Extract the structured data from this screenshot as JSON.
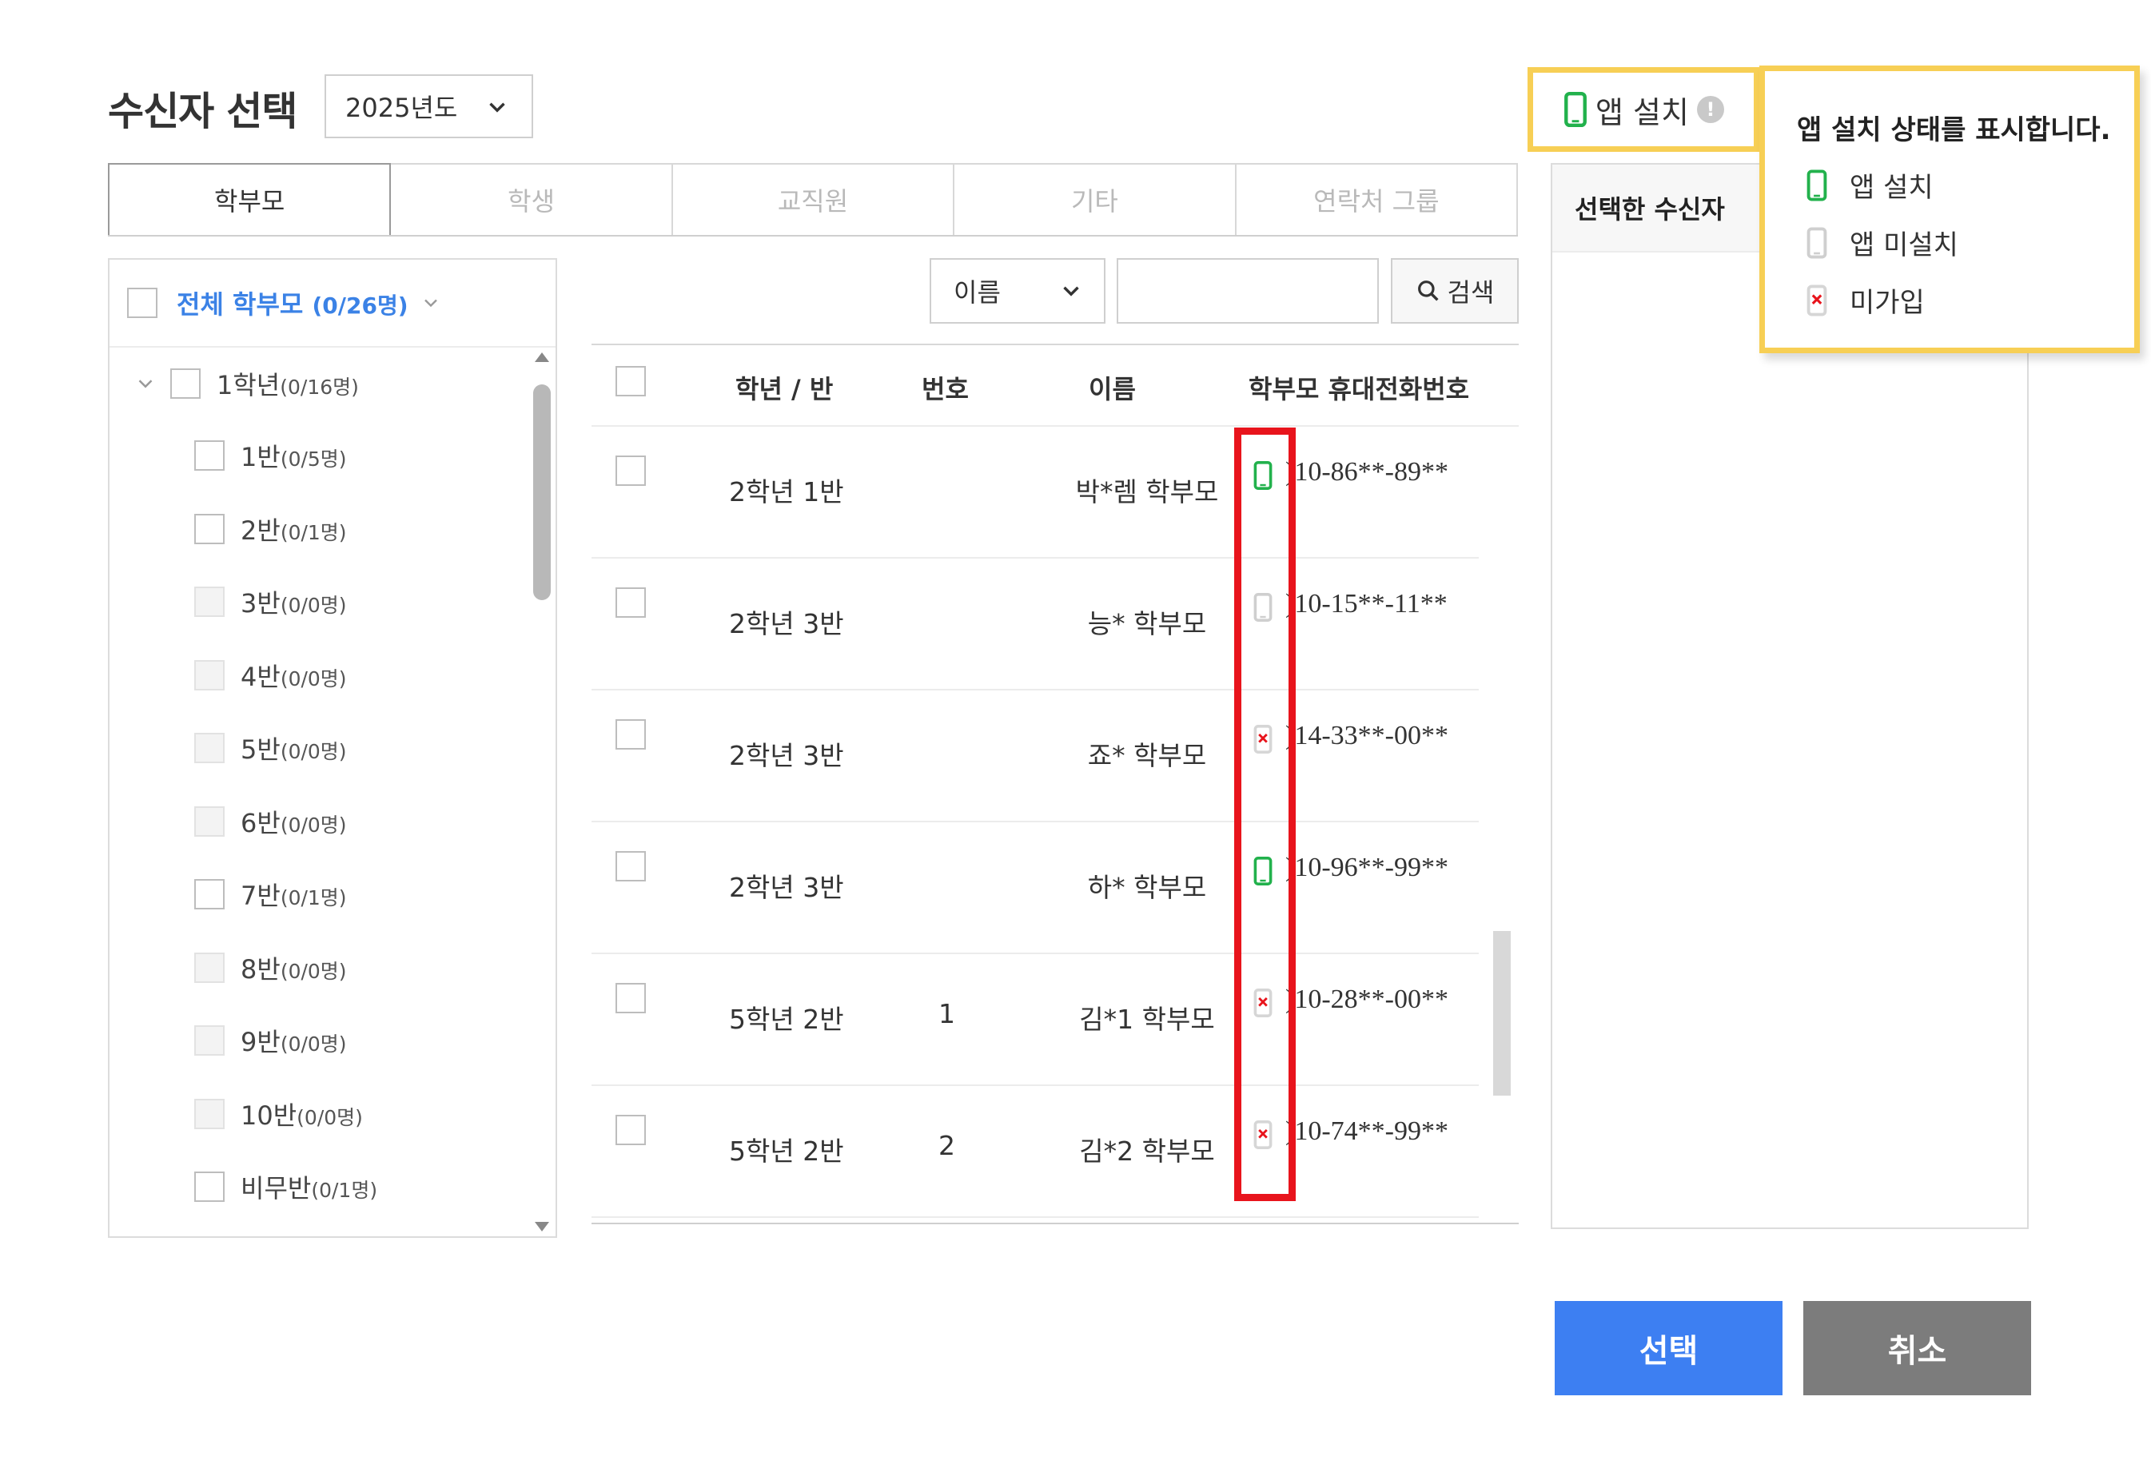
{
  "header": {
    "title": "수신자 선택",
    "year": "2025년도"
  },
  "tabs": [
    {
      "label": "학부모",
      "active": true
    },
    {
      "label": "학생",
      "active": false
    },
    {
      "label": "교직원",
      "active": false
    },
    {
      "label": "기타",
      "active": false
    },
    {
      "label": "연락처 그룹",
      "active": false
    }
  ],
  "tree": {
    "all_label": "전체 학부모",
    "all_count": "(0/26명)",
    "grade": {
      "label": "1학년",
      "count": "(0/16명)"
    },
    "classes": [
      {
        "label": "1반",
        "count": "(0/5명)",
        "enabled": true
      },
      {
        "label": "2반",
        "count": "(0/1명)",
        "enabled": true
      },
      {
        "label": "3반",
        "count": "(0/0명)",
        "enabled": false
      },
      {
        "label": "4반",
        "count": "(0/0명)",
        "enabled": false
      },
      {
        "label": "5반",
        "count": "(0/0명)",
        "enabled": false
      },
      {
        "label": "6반",
        "count": "(0/0명)",
        "enabled": false
      },
      {
        "label": "7반",
        "count": "(0/1명)",
        "enabled": true
      },
      {
        "label": "8반",
        "count": "(0/0명)",
        "enabled": false
      },
      {
        "label": "9반",
        "count": "(0/0명)",
        "enabled": false
      },
      {
        "label": "10반",
        "count": "(0/0명)",
        "enabled": false
      },
      {
        "label": "비무반",
        "count": "(0/1명)",
        "enabled": true
      }
    ]
  },
  "search": {
    "field": "이름",
    "query": "",
    "button_label": "검색"
  },
  "table": {
    "columns": [
      "학년 / 반",
      "번호",
      "이름",
      "학부모 휴대전화번호"
    ],
    "rows": [
      {
        "class": "2학년 1반",
        "number": "",
        "name": "박*렘 학부모",
        "status": "installed",
        "phone": ")10-86**-89**"
      },
      {
        "class": "2학년 3반",
        "number": "",
        "name": "능* 학부모",
        "status": "not_installed",
        "phone": ")10-15**-11**"
      },
      {
        "class": "2학년 3반",
        "number": "",
        "name": "죠* 학부모",
        "status": "not_joined",
        "phone": ")14-33**-00**"
      },
      {
        "class": "2학년 3반",
        "number": "",
        "name": "하* 학부모",
        "status": "installed",
        "phone": ")10-96**-99**"
      },
      {
        "class": "5학년 2반",
        "number": "1",
        "name": "김*1 학부모",
        "status": "not_joined",
        "phone": ")10-28**-00**"
      },
      {
        "class": "5학년 2반",
        "number": "2",
        "name": "김*2 학부모",
        "status": "not_joined",
        "phone": ")10-74**-99**"
      }
    ]
  },
  "selected_panel": {
    "title": "선택한 수신자"
  },
  "app_install": {
    "label": "앱 설치",
    "info_icon": "!"
  },
  "tooltip": {
    "title": "앱 설치 상태를 표시합니다.",
    "items": [
      {
        "icon": "phone-installed-icon",
        "label": "앱 설치"
      },
      {
        "icon": "phone-not-installed-icon",
        "label": "앱 미설치"
      },
      {
        "icon": "phone-not-joined-icon",
        "label": "미가입"
      }
    ]
  },
  "buttons": {
    "select": "선택",
    "cancel": "취소"
  },
  "colors": {
    "accent_blue": "#3d7ff2",
    "cancel_gray": "#7c7c7c",
    "highlight_yellow": "#f7cf55",
    "annotation_red": "#e8141c",
    "installed_green": "#22b14c"
  }
}
